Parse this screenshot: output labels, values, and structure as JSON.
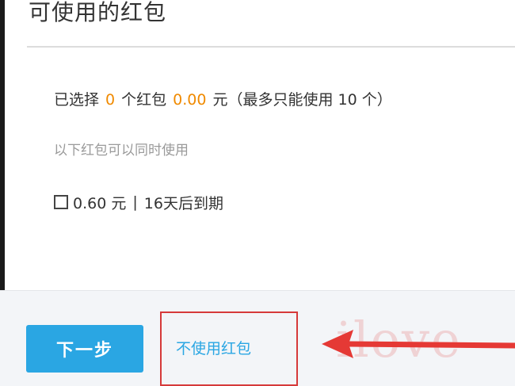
{
  "dialog": {
    "title": "可使用的红包"
  },
  "summary": {
    "prefix": "已选择",
    "count": "0",
    "count_unit": "个红包",
    "amount": "0.00",
    "amount_unit": "元",
    "limit_text": "（最多只能使用 10 个）"
  },
  "hint": "以下红包可以同时使用",
  "coupons": [
    {
      "checked": false,
      "amount": "0.60 元",
      "separator": "|",
      "expiry": "16天后到期"
    }
  ],
  "footer": {
    "next_label": "下一步",
    "no_coupon_label": "不使用红包"
  },
  "annotation": {
    "highlight_color": "#d63a3a",
    "arrow_color": "#e53935"
  },
  "watermark": "ilove",
  "colors": {
    "accent": "#2aa6e3",
    "highlight_number": "#f08a00",
    "text": "#333333",
    "muted": "#9a9a9a"
  }
}
